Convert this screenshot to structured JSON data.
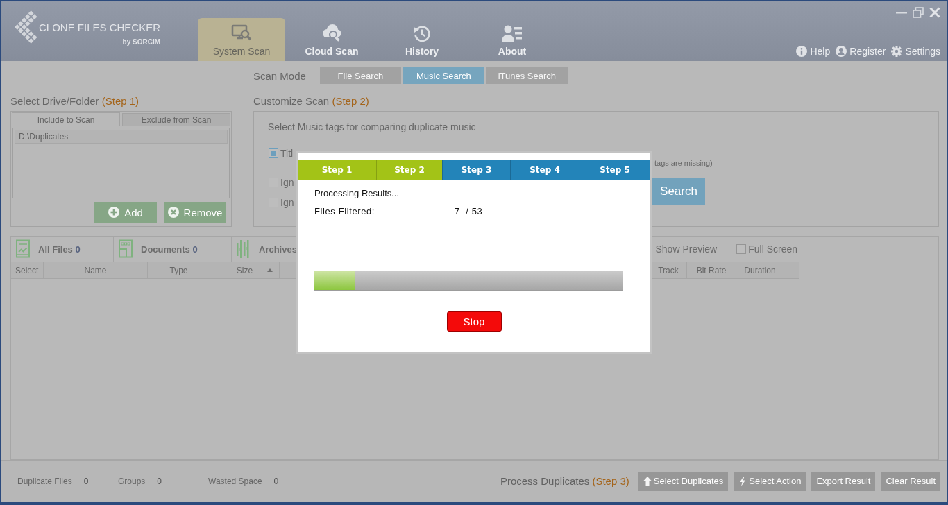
{
  "header": {
    "logo": {
      "title": "CLONE FILES CHECKER",
      "subtitle": "by SORCIM"
    },
    "tabs": [
      {
        "label": "System Scan",
        "selected": true
      },
      {
        "label": "Cloud Scan",
        "selected": false
      },
      {
        "label": "History",
        "selected": false
      },
      {
        "label": "About",
        "selected": false
      }
    ],
    "links": [
      {
        "label": "Help"
      },
      {
        "label": "Register"
      },
      {
        "label": "Settings"
      }
    ]
  },
  "scan_mode": {
    "label": "Scan Mode",
    "options": [
      {
        "label": "File Search",
        "selected": false
      },
      {
        "label": "Music Search",
        "selected": true
      },
      {
        "label": "iTunes Search",
        "selected": false
      }
    ]
  },
  "select_folder": {
    "title": "Select Drive/Folder",
    "step": "(Step 1)",
    "tabs": [
      {
        "label": "Include to Scan",
        "selected": true
      },
      {
        "label": "Exclude from Scan",
        "selected": false
      }
    ],
    "paths": [
      "D:\\Duplicates"
    ],
    "buttons": [
      {
        "label": "Add"
      },
      {
        "label": "Remove"
      }
    ]
  },
  "customize_scan": {
    "title": "Customize Scan",
    "step": "(Step 2)",
    "prompt": "Select Music tags for comparing duplicate music",
    "tags": [
      {
        "label": "Titl",
        "checked": true
      }
    ],
    "ignore_options": [
      {
        "label": "Ign",
        "checked": false
      },
      {
        "label": "Ign",
        "checked": false
      }
    ],
    "note": "tags are missing)",
    "search_button": "Search"
  },
  "categories": [
    {
      "label": "All Files",
      "count": "0"
    },
    {
      "label": "Documents",
      "count": "0"
    },
    {
      "label": "Archives"
    }
  ],
  "view_options": [
    {
      "label": "Show Preview"
    },
    {
      "label": "Full Screen",
      "checked": false
    }
  ],
  "table": {
    "columns": [
      {
        "label": "Select",
        "sorted": false
      },
      {
        "label": "Name",
        "sorted": false
      },
      {
        "label": "Type",
        "sorted": false
      },
      {
        "label": "Size",
        "sorted": true
      },
      {
        "label": "Track",
        "sorted": false
      },
      {
        "label": "Bit Rate",
        "sorted": false
      },
      {
        "label": "Duration",
        "sorted": false
      }
    ]
  },
  "summary": [
    {
      "label": "Duplicate Files",
      "value": "0"
    },
    {
      "label": "Groups",
      "value": "0"
    },
    {
      "label": "Wasted Space",
      "value": "0"
    }
  ],
  "process": {
    "title": "Process Duplicates",
    "step": "(Step 3)",
    "buttons": [
      {
        "label": "Select Duplicates"
      },
      {
        "label": "Select Action"
      },
      {
        "label": "Export Result"
      },
      {
        "label": "Clear Result"
      }
    ]
  },
  "dialog": {
    "steps": [
      {
        "label": "Step 1",
        "completed": true
      },
      {
        "label": "Step 2",
        "completed": true
      },
      {
        "label": "Step 3",
        "completed": false
      },
      {
        "label": "Step 4",
        "completed": false
      },
      {
        "label": "Step 5",
        "completed": false
      }
    ],
    "status": "Processing Results...",
    "counter_label": "Files Filtered:",
    "counter_value": "7  / 53",
    "progress": {
      "level": 0.13
    },
    "stop_button": "Stop"
  }
}
